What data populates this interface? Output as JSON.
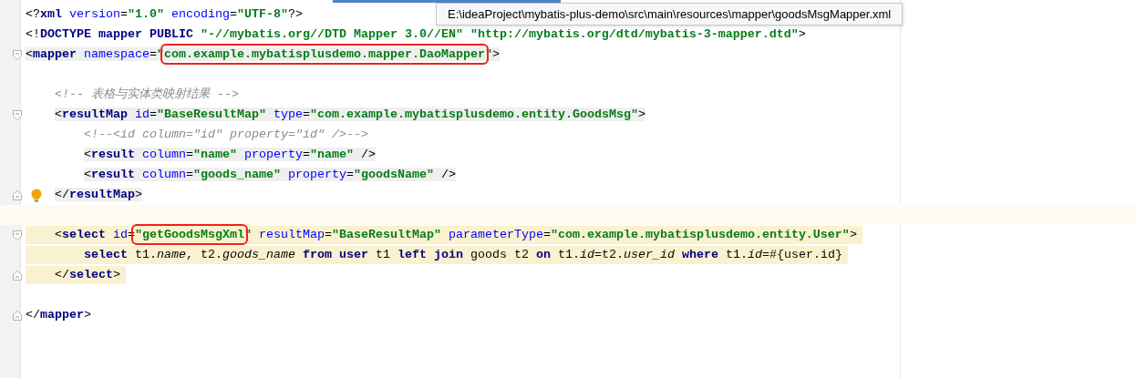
{
  "editor_tab_indicator": {
    "selected": true
  },
  "tooltip": "E:\\ideaProject\\mybatis-plus-demo\\src\\main\\resources\\mapper\\goodsMsgMapper.xml",
  "lines": [
    {
      "kind": "code",
      "tokens": [
        {
          "kind": "punct",
          "t": "<?"
        },
        {
          "kind": "tag",
          "t": "xml"
        },
        {
          "kind": "attr",
          "t": " version"
        },
        {
          "kind": "punct",
          "t": "="
        },
        {
          "kind": "value",
          "t": "\"1.0\""
        },
        {
          "kind": "attr",
          "t": " encoding"
        },
        {
          "kind": "punct",
          "t": "="
        },
        {
          "kind": "value",
          "t": "\"UTF-8\""
        },
        {
          "kind": "punct",
          "t": "?>"
        }
      ]
    },
    {
      "kind": "code",
      "tokens": [
        {
          "kind": "punct",
          "t": "<!"
        },
        {
          "kind": "tag",
          "t": "DOCTYPE mapper PUBLIC"
        },
        {
          "kind": "value",
          "t": " \"-//mybatis.org//DTD Mapper 3.0//EN\" \"http://mybatis.org/dtd/mybatis-3-mapper.dtd\""
        },
        {
          "kind": "punct",
          "t": ">"
        }
      ]
    },
    {
      "kind": "code",
      "tag_highlight": true,
      "fold_start": true,
      "tokens": [
        {
          "kind": "punct",
          "t": "<"
        },
        {
          "kind": "tag",
          "t": "mapper"
        },
        {
          "kind": "attr",
          "t": " namespace"
        },
        {
          "kind": "punct",
          "t": "="
        },
        {
          "kind": "value",
          "t": "\""
        },
        {
          "kind": "value",
          "t": "com.example.mybatisplusdemo.mapper.DaoMapper",
          "boxed": true
        },
        {
          "kind": "value",
          "t": "\""
        },
        {
          "kind": "punct",
          "t": ">"
        }
      ],
      "children": [
        {
          "kind": "blank"
        },
        {
          "kind": "code",
          "tokens": [
            {
              "kind": "comment",
              "t": "<!-- 表格与实体类映射结果 -->"
            }
          ]
        },
        {
          "kind": "code",
          "tag_highlight": true,
          "fold_start": true,
          "tokens": [
            {
              "kind": "punct",
              "t": "<"
            },
            {
              "kind": "tag",
              "t": "resultMap"
            },
            {
              "kind": "attr",
              "t": " id"
            },
            {
              "kind": "punct",
              "t": "="
            },
            {
              "kind": "value",
              "t": "\"BaseResultMap\""
            },
            {
              "kind": "attr",
              "t": " type"
            },
            {
              "kind": "punct",
              "t": "="
            },
            {
              "kind": "value",
              "t": "\"com.example.mybatisplusdemo.entity.GoodsMsg\""
            },
            {
              "kind": "punct",
              "t": ">"
            }
          ],
          "children": [
            {
              "kind": "code",
              "tokens": [
                {
                  "kind": "comment",
                  "t": "<!--<id column=\"id\" property=\"id\" />-->"
                }
              ]
            },
            {
              "kind": "code",
              "tag_highlight": true,
              "tokens": [
                {
                  "kind": "punct",
                  "t": "<"
                },
                {
                  "kind": "tag",
                  "t": "result"
                },
                {
                  "kind": "attr",
                  "t": " column"
                },
                {
                  "kind": "punct",
                  "t": "="
                },
                {
                  "kind": "value",
                  "t": "\"name\""
                },
                {
                  "kind": "attr",
                  "t": " property"
                },
                {
                  "kind": "punct",
                  "t": "="
                },
                {
                  "kind": "value",
                  "t": "\"name\""
                },
                {
                  "kind": "punct",
                  "t": " />"
                }
              ]
            },
            {
              "kind": "code",
              "tag_highlight": true,
              "tokens": [
                {
                  "kind": "punct",
                  "t": "<"
                },
                {
                  "kind": "tag",
                  "t": "result"
                },
                {
                  "kind": "attr",
                  "t": " column"
                },
                {
                  "kind": "punct",
                  "t": "="
                },
                {
                  "kind": "value",
                  "t": "\"goods_name\""
                },
                {
                  "kind": "attr",
                  "t": " property"
                },
                {
                  "kind": "punct",
                  "t": "="
                },
                {
                  "kind": "value",
                  "t": "\"goodsName\""
                },
                {
                  "kind": "punct",
                  "t": " />"
                }
              ]
            }
          ]
        },
        {
          "kind": "code",
          "tag_highlight": true,
          "fold_end": true,
          "bulb": true,
          "tokens": [
            {
              "kind": "punct",
              "t": "</"
            },
            {
              "kind": "tag",
              "t": "resultMap"
            },
            {
              "kind": "punct",
              "t": ">"
            }
          ]
        },
        {
          "kind": "blank",
          "current": true
        },
        {
          "kind": "code",
          "injected": true,
          "fold_start": true,
          "tokens": [
            {
              "kind": "punct",
              "t": "<"
            },
            {
              "kind": "tag",
              "t": "select"
            },
            {
              "kind": "attr",
              "t": " id"
            },
            {
              "kind": "punct",
              "t": "="
            },
            {
              "kind": "value",
              "t": "\"getGoodsMsgXml",
              "boxed": true
            },
            {
              "kind": "value",
              "t": "\""
            },
            {
              "kind": "attr",
              "t": " resultMap"
            },
            {
              "kind": "punct",
              "t": "="
            },
            {
              "kind": "value",
              "t": "\"BaseResultMap\""
            },
            {
              "kind": "attr",
              "t": " parameterType"
            },
            {
              "kind": "punct",
              "t": "="
            },
            {
              "kind": "value",
              "t": "\"com.example.mybatisplusdemo.entity.User\""
            },
            {
              "kind": "punct",
              "t": ">"
            }
          ],
          "children": [
            {
              "kind": "code",
              "injected": true,
              "tokens": [
                {
                  "kind": "kw",
                  "t": "select"
                },
                {
                  "kind": "plain",
                  "t": " t1."
                },
                {
                  "kind": "field",
                  "t": "name"
                },
                {
                  "kind": "plain",
                  "t": ", t2."
                },
                {
                  "kind": "field",
                  "t": "goods_name"
                },
                {
                  "kind": "kw",
                  "t": " from user"
                },
                {
                  "kind": "plain",
                  "t": " t1 "
                },
                {
                  "kind": "kw",
                  "t": "left join"
                },
                {
                  "kind": "plain",
                  "t": " goods t2 "
                },
                {
                  "kind": "kw",
                  "t": "on"
                },
                {
                  "kind": "plain",
                  "t": " t1."
                },
                {
                  "kind": "field",
                  "t": "id"
                },
                {
                  "kind": "plain",
                  "t": "=t2."
                },
                {
                  "kind": "field",
                  "t": "user_id"
                },
                {
                  "kind": "kw",
                  "t": " where"
                },
                {
                  "kind": "plain",
                  "t": " t1."
                },
                {
                  "kind": "field",
                  "t": "id"
                },
                {
                  "kind": "plain",
                  "t": "=#{user.id}"
                }
              ]
            }
          ]
        },
        {
          "kind": "code",
          "injected": true,
          "fold_end": true,
          "tokens": [
            {
              "kind": "punct",
              "t": "</"
            },
            {
              "kind": "tag",
              "t": "select"
            },
            {
              "kind": "punct",
              "t": ">"
            }
          ]
        },
        {
          "kind": "blank"
        }
      ]
    },
    {
      "kind": "code",
      "fold_end": true,
      "tokens": [
        {
          "kind": "punct",
          "t": "</"
        },
        {
          "kind": "tag",
          "t": "mapper"
        },
        {
          "kind": "punct",
          "t": ">"
        }
      ]
    }
  ]
}
